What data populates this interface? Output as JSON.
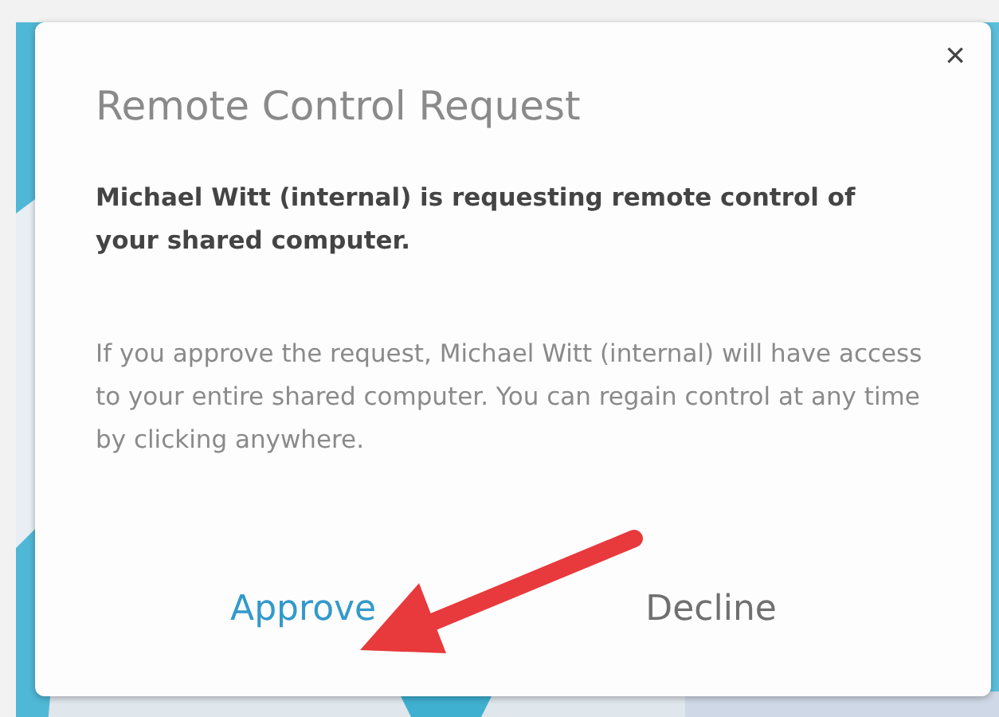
{
  "dialog": {
    "title": "Remote Control Request",
    "close": "×",
    "message": "Michael Witt (internal) is requesting remote control of your shared computer.",
    "details": "If you approve the request, Michael Witt (internal) will have access to your entire shared computer. You can regain control at any time by clicking anywhere.",
    "buttons": [
      {
        "label": "Approve",
        "kind": "primary"
      },
      {
        "label": "Decline",
        "kind": "secondary"
      }
    ]
  }
}
